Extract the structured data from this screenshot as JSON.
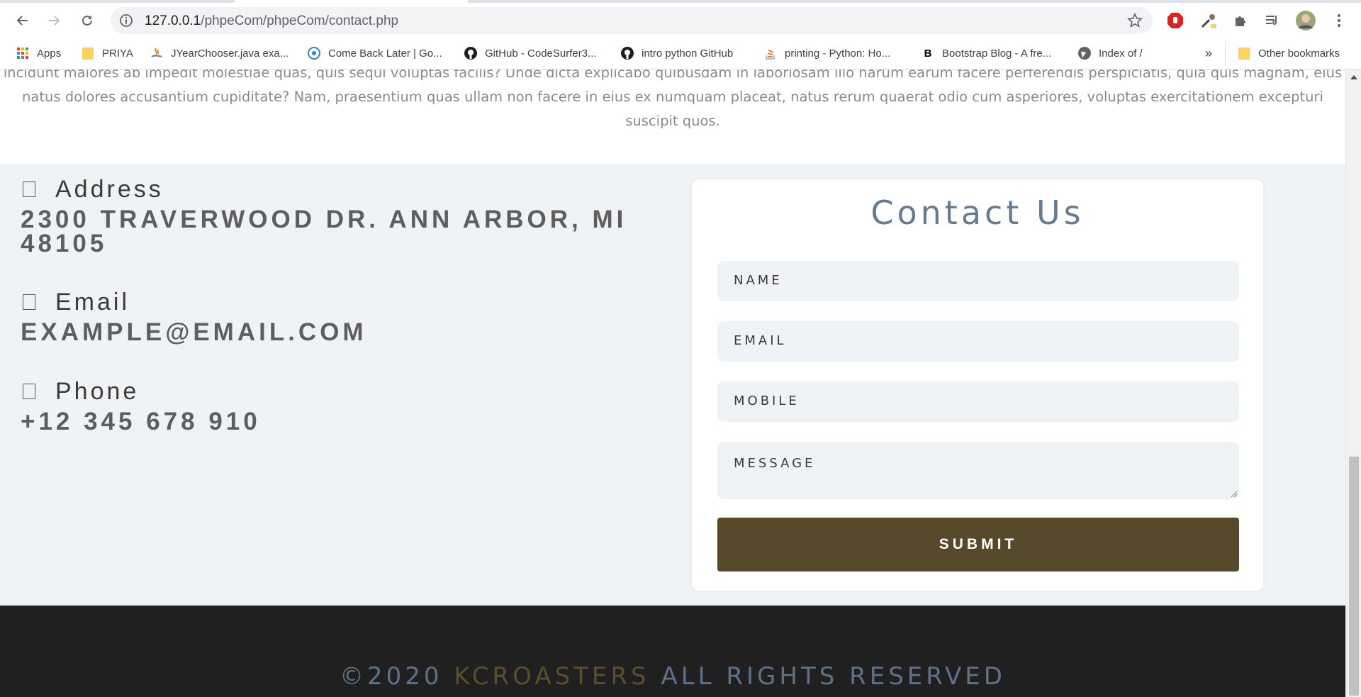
{
  "browser": {
    "url_host": "127.0.0.1",
    "url_path": "/phpeCom/phpeCom/contact.php",
    "bookmarks": [
      {
        "label": "Apps",
        "icon": "apps-grid-icon"
      },
      {
        "label": "PRIYA",
        "icon": "folder-icon"
      },
      {
        "label": "JYearChooser.java exa...",
        "icon": "java-icon"
      },
      {
        "label": "Come Back Later | Go...",
        "icon": "atom-icon"
      },
      {
        "label": "GitHub - CodeSurfer3...",
        "icon": "github-icon"
      },
      {
        "label": "intro python GitHub",
        "icon": "github-icon"
      },
      {
        "label": "printing - Python: Ho...",
        "icon": "stackoverflow-icon"
      },
      {
        "label": "Bootstrap Blog - A fre...",
        "icon": "bold-b-icon"
      },
      {
        "label": "Index of /",
        "icon": "globe-icon"
      }
    ],
    "overflow_label": "»",
    "other_bookmarks": "Other bookmarks"
  },
  "intro": {
    "text": "incidunt maiores ab impedit molestiae quas, quis sequi voluptas facilis? Unde dicta explicabo quibusdam in laboriosam illo harum earum facere perferendis perspiciatis, quia quis magnam, eius natus dolores accusantium cupiditate? Nam, praesentium quas ullam non facere in eius ex numquam placeat, natus rerum quaerat odio cum asperiores, voluptas exercitationem excepturi suscipit quos."
  },
  "contact_info": {
    "address_label": "Address",
    "address_value": "2300 Traverwood Dr. Ann Arbor, MI 48105",
    "email_label": "Email",
    "email_value": "example@email.com",
    "phone_label": "Phone",
    "phone_value": "+12 345 678 910"
  },
  "form": {
    "title": "Contact Us",
    "name_placeholder": "NAME",
    "email_placeholder": "EMAIL",
    "mobile_placeholder": "MOBILE",
    "message_placeholder": "MESSAGE",
    "submit_label": "SUBMIT"
  },
  "footer": {
    "prefix": "©2020",
    "brand": "KCROASTERS",
    "suffix": "ALL RIGHTS RESERVED"
  },
  "colors": {
    "submit_bg": "#574a2a",
    "title_color": "#667b8f",
    "footer_bg": "#202020"
  }
}
